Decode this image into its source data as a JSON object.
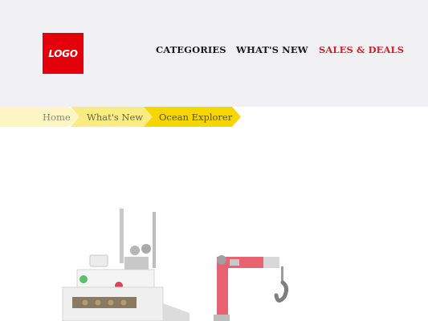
{
  "header": {
    "logo_text": "LOGO",
    "nav": [
      "CATEGORIES",
      "WHAT'S NEW",
      "SALES & DEALS"
    ],
    "accent_color": "#d0202a",
    "logo_color": "#e3000b"
  },
  "breadcrumb": [
    "Home",
    "What's New",
    "Ocean Explorer"
  ],
  "product": {
    "image_alt": "Ocean Explorer boat and crane build"
  }
}
